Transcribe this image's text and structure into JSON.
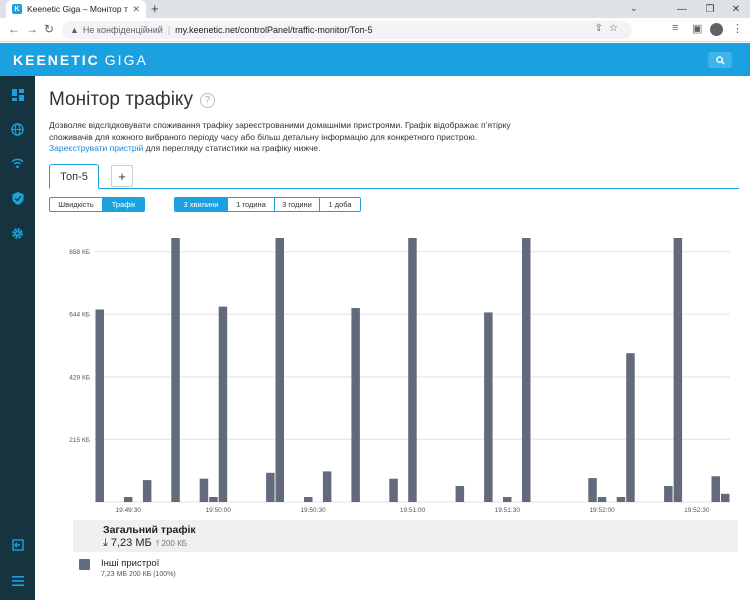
{
  "browser": {
    "tab_title": "Keenetic Giga – Монітор трафік",
    "new_tab": "+",
    "not_secure": "Не конфіденційний",
    "url": "my.keenetic.net/controlPanel/traffic-monitor/Топ-5"
  },
  "header": {
    "logo_main": "KEENETIC",
    "logo_model": "GIGA"
  },
  "page": {
    "title": "Монітор трафіку",
    "description_text": "Дозволяє відслідковувати споживання трафіку зареєстрованими домашніми пристроями. Графік відображає п’ятірку споживачів для кожного вибраного періоду часу або більш детальну інформацію для конкретного пристрою.",
    "register_link": "Зареєструвати пристрій",
    "register_suffix": " для перегляду статистики на графіку нижче.",
    "tabs": [
      "Топ-5",
      "+"
    ],
    "mode_buttons": [
      "Швидкість",
      "Трафік"
    ],
    "active_mode": "Трафік",
    "period_buttons": [
      "3 хвилини",
      "1 година",
      "3 години",
      "1 доба"
    ],
    "active_period": "3 хвилини"
  },
  "chart_data": {
    "type": "bar",
    "title": "",
    "xlabel": "",
    "ylabel": "",
    "ylim": [
      0,
      905
    ],
    "ytick_values": [
      215,
      429,
      644,
      858
    ],
    "ytick_labels": [
      "215 КБ",
      "429 КБ",
      "644 КБ",
      "858 КБ"
    ],
    "x_tick_labels": [
      "19:49:30",
      "19:50:00",
      "19:50:30",
      "19:51:00",
      "19:51:30",
      "19:52:00",
      "19:52:30"
    ],
    "x_tick_index": [
      3.5,
      13,
      23,
      33.5,
      43.5,
      53.5,
      63.5
    ],
    "series": [
      {
        "name": "Інші пристрої",
        "color": "#636a7c",
        "values": [
          660,
          0,
          0,
          17,
          0,
          75,
          0,
          0,
          905,
          0,
          0,
          80,
          17,
          670,
          0,
          0,
          0,
          0,
          100,
          905,
          0,
          0,
          17,
          0,
          105,
          0,
          0,
          665,
          0,
          0,
          0,
          80,
          0,
          905,
          0,
          0,
          0,
          0,
          55,
          0,
          0,
          650,
          0,
          17,
          0,
          905,
          0,
          0,
          0,
          0,
          0,
          0,
          82,
          17,
          0,
          17,
          510,
          0,
          0,
          0,
          55,
          905,
          0,
          0,
          0,
          88,
          28
        ]
      }
    ],
    "grid": true,
    "legend": "bottom-left"
  },
  "summary": {
    "title": "Загальний трафік",
    "total_down": "7,23 МБ",
    "total_up": "200 КБ"
  },
  "legend": {
    "name": "Інші пристрої",
    "values": "7,23 МБ  200 КБ (100%)"
  }
}
